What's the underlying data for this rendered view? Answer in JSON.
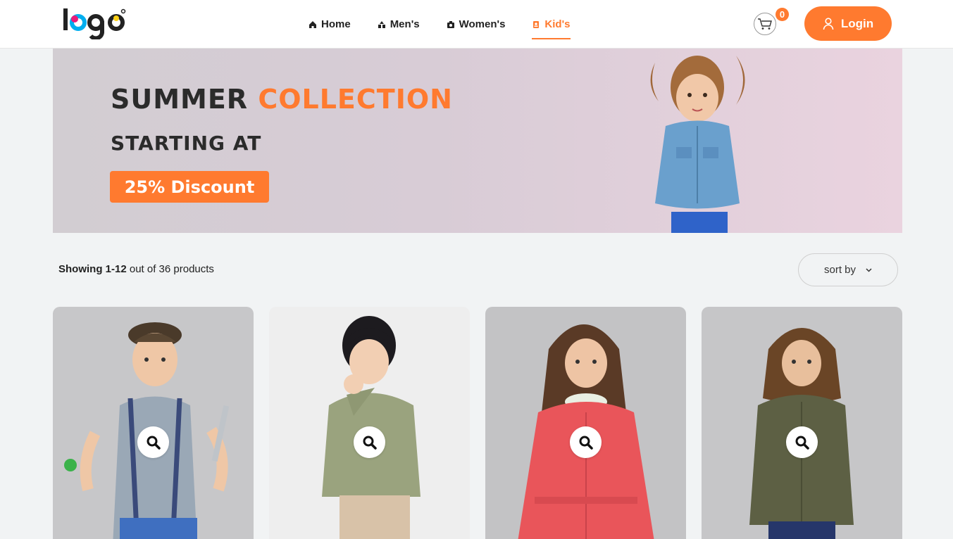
{
  "header": {
    "logo_text": "logo",
    "nav": [
      {
        "label": "Home",
        "icon": "home-icon"
      },
      {
        "label": "Men's",
        "icon": "men-icon"
      },
      {
        "label": "Women's",
        "icon": "women-icon"
      },
      {
        "label": "Kid's",
        "icon": "kids-icon",
        "active": true
      }
    ],
    "cart_count": "0",
    "login_label": "Login"
  },
  "banner": {
    "line1_a": "SUMMER",
    "line1_b": "COLLECTION",
    "line2": "STARTING AT",
    "cta": "25% Discount"
  },
  "listing": {
    "showing_bold": "Showing 1-12",
    "showing_rest": " out of 36 products",
    "sort_label": "sort by"
  },
  "products": [
    {
      "bg": "#c7c7c9",
      "name": "boy-suspenders"
    },
    {
      "bg": "#eeeeee",
      "name": "boy-green-sweater"
    },
    {
      "bg": "#c3c3c5",
      "name": "girl-red-coat"
    },
    {
      "bg": "#c6c6c8",
      "name": "boy-olive-shirt"
    }
  ],
  "colors": {
    "accent": "#ff7a2f",
    "page_bg": "#f1f3f4"
  }
}
